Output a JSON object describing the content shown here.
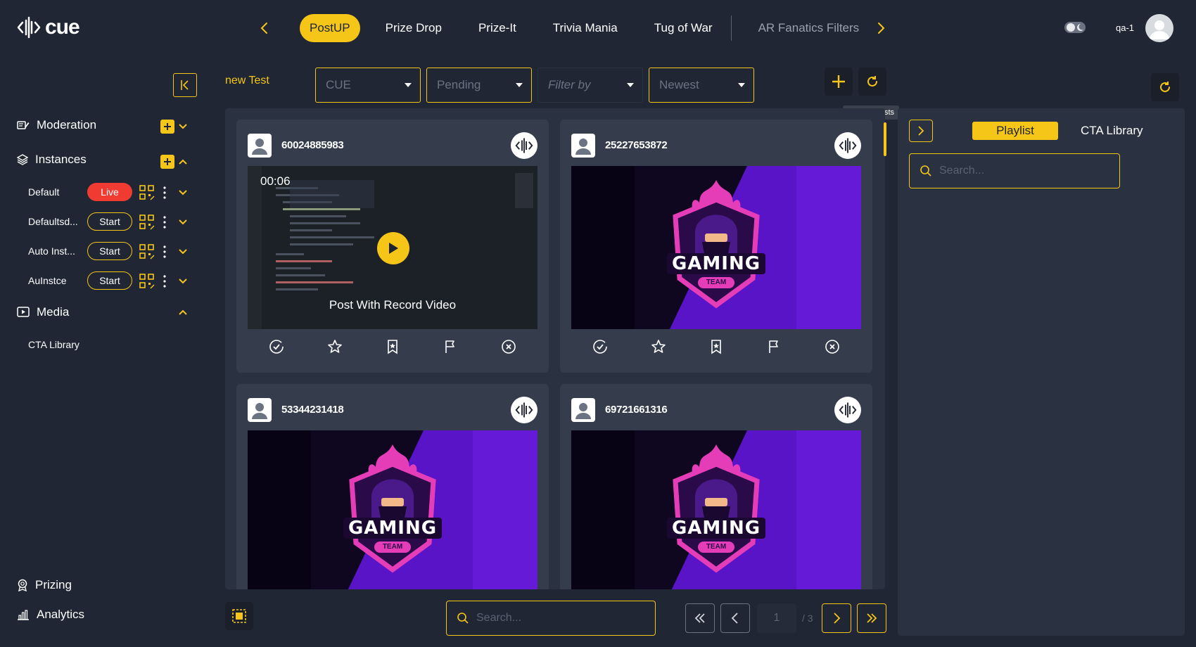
{
  "app": {
    "logo_text": "cue"
  },
  "topnav": {
    "tabs": [
      {
        "label": "PostUP",
        "active": true
      },
      {
        "label": "Prize Drop"
      },
      {
        "label": "Prize-It"
      },
      {
        "label": "Trivia Mania"
      },
      {
        "label": "Tug of War"
      },
      {
        "label": "AR Fanatics Filters",
        "muted": true
      }
    ],
    "username": "qa-1"
  },
  "sidebar": {
    "moderation_label": "Moderation",
    "instances_label": "Instances",
    "instances": [
      {
        "name": "Default",
        "status": "Live"
      },
      {
        "name": "Defaultsd...",
        "status": "Start"
      },
      {
        "name": "Auto Inst...",
        "status": "Start"
      },
      {
        "name": "AuInstce",
        "status": "Start"
      }
    ],
    "media_label": "Media",
    "media_items": [
      "CTA Library"
    ],
    "prizing_label": "Prizing",
    "analytics_label": "Analytics"
  },
  "main": {
    "title": "new Test",
    "filters": [
      {
        "value": "CUE"
      },
      {
        "value": "Pending"
      },
      {
        "placeholder": "Filter by"
      },
      {
        "value": "Newest"
      }
    ],
    "tooltip": "Update Posts",
    "posts": [
      {
        "id": "60024885983",
        "type": "video",
        "timer": "00:06",
        "caption": "Post With Record Video"
      },
      {
        "id": "25227653872",
        "type": "image",
        "image_label": "GAMING",
        "image_sublabel": "TEAM"
      },
      {
        "id": "53344231418",
        "type": "image",
        "image_label": "GAMING",
        "image_sublabel": "TEAM"
      },
      {
        "id": "69721661316",
        "type": "image",
        "image_label": "GAMING",
        "image_sublabel": "TEAM"
      }
    ],
    "search_placeholder": "Search...",
    "pagination": {
      "current": "1",
      "total_label": "/ 3"
    }
  },
  "right_panel": {
    "tabs": [
      {
        "label": "Playlist",
        "active": true
      },
      {
        "label": "CTA Library"
      }
    ],
    "search_placeholder": "Search..."
  },
  "colors": {
    "accent": "#f5c518",
    "live": "#ef3b32",
    "bg": "#202634",
    "panel": "#2a3140",
    "card": "#353c4b"
  }
}
